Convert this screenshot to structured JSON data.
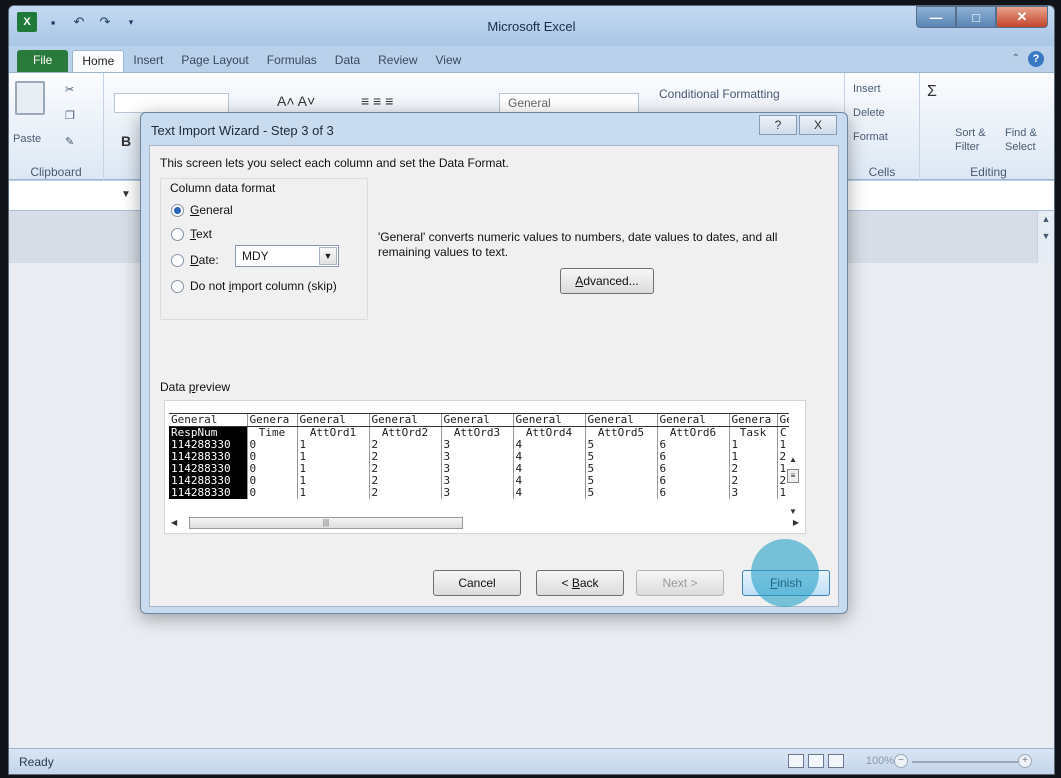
{
  "window": {
    "title": "Microsoft Excel"
  },
  "ribbon_tabs": [
    "File",
    "Home",
    "Insert",
    "Page Layout",
    "Formulas",
    "Data",
    "Review",
    "View"
  ],
  "ribbon": {
    "paste_label": "Paste",
    "clipboard_group": "Clipboard",
    "number_format": "General",
    "conditional_formatting": "Conditional Formatting",
    "insert": "Insert",
    "delete": "Delete",
    "format": "Format",
    "cells_group": "Cells",
    "sort_filter_1": "Sort &",
    "sort_filter_2": "Filter",
    "find_select_1": "Find &",
    "find_select_2": "Select",
    "editing_group": "Editing",
    "bold_label": "B"
  },
  "dialog": {
    "title": "Text Import Wizard - Step 3 of 3",
    "help_btn": "?",
    "close_btn": "X",
    "intro": "This screen lets you select each column and set the Data Format.",
    "column_format_title": "Column data format",
    "options": {
      "general": {
        "pre": "",
        "key": "G",
        "post": "eneral"
      },
      "text": {
        "pre": "",
        "key": "T",
        "post": "ext"
      },
      "date": {
        "pre": "",
        "key": "D",
        "post": "ate:"
      },
      "skip": {
        "pre": "Do not ",
        "key": "i",
        "post": "mport column (skip)"
      }
    },
    "selected_option": "general",
    "date_value": "MDY",
    "description": "'General' converts numeric values to numbers, date values to dates, and all remaining values to text.",
    "advanced_button": {
      "key": "A",
      "post": "dvanced..."
    },
    "preview_title": {
      "key": "p",
      "pre": "Data ",
      "post": "review"
    },
    "preview": {
      "headers": [
        "General",
        "Genera",
        "General",
        "General",
        "General",
        "General",
        "General",
        "General",
        "Genera",
        "Ge"
      ],
      "rows": [
        [
          "RespNum",
          "Time",
          "AttOrd1",
          "AttOrd2",
          "AttOrd3",
          "AttOrd4",
          "AttOrd5",
          "AttOrd6",
          "Task",
          "C"
        ],
        [
          "114288330",
          "0",
          "1",
          "2",
          "3",
          "4",
          "5",
          "6",
          "1",
          "1"
        ],
        [
          "114288330",
          "0",
          "1",
          "2",
          "3",
          "4",
          "5",
          "6",
          "1",
          "2"
        ],
        [
          "114288330",
          "0",
          "1",
          "2",
          "3",
          "4",
          "5",
          "6",
          "2",
          "1"
        ],
        [
          "114288330",
          "0",
          "1",
          "2",
          "3",
          "4",
          "5",
          "6",
          "2",
          "2"
        ],
        [
          "114288330",
          "0",
          "1",
          "2",
          "3",
          "4",
          "5",
          "6",
          "3",
          "1"
        ]
      ]
    },
    "buttons": {
      "cancel": "Cancel",
      "back": {
        "pre": "< ",
        "key": "B",
        "post": "ack"
      },
      "next": "Next >",
      "finish": {
        "key": "F",
        "post": "inish"
      }
    }
  },
  "status": {
    "ready": "Ready",
    "zoom": "100%"
  }
}
